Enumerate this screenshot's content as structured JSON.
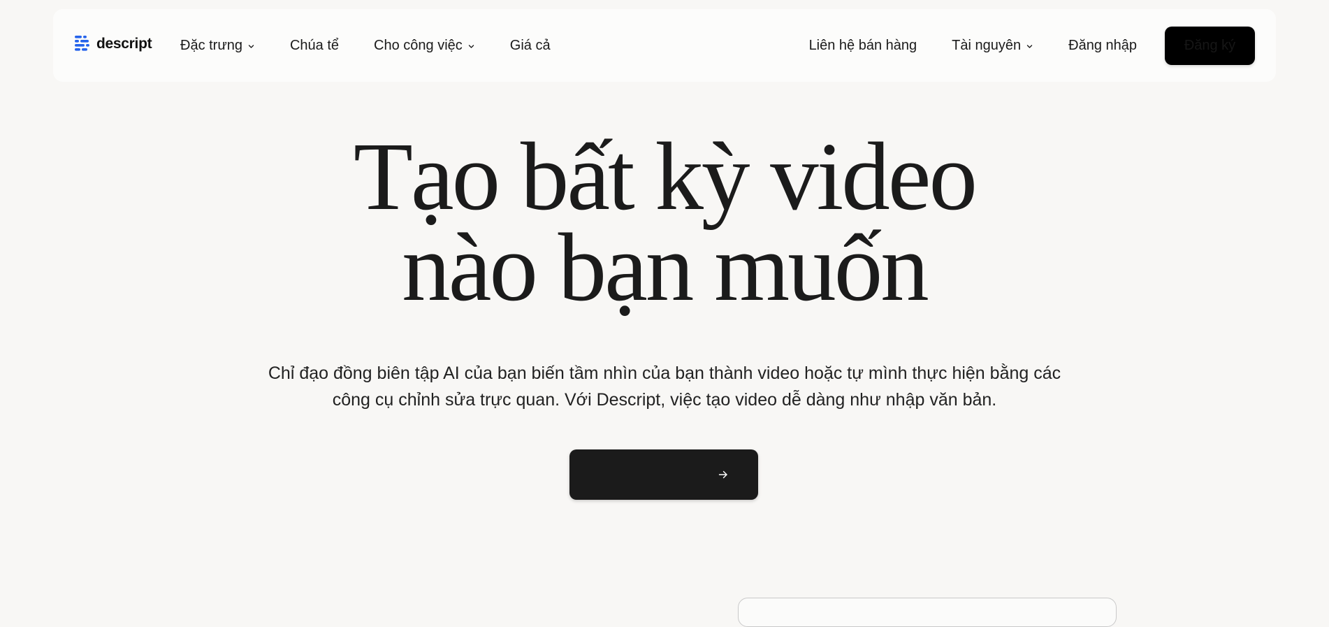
{
  "brand": {
    "name": "descript",
    "logo_icon": "descript-logo-icon",
    "accent_color": "#2563eb"
  },
  "nav": {
    "left": [
      {
        "label": "Đặc trưng",
        "has_dropdown": true
      },
      {
        "label": "Chúa tể",
        "has_dropdown": false
      },
      {
        "label": "Cho công việc",
        "has_dropdown": true
      },
      {
        "label": "Giá cả",
        "has_dropdown": false
      }
    ],
    "right": [
      {
        "label": "Liên hệ bán hàng",
        "has_dropdown": false
      },
      {
        "label": "Tài nguyên",
        "has_dropdown": true
      },
      {
        "label": "Đăng nhập",
        "has_dropdown": false
      }
    ],
    "signup_label": "Đăng ký"
  },
  "hero": {
    "title_line1": "Tạo bất kỳ video",
    "title_line2": "nào bạn muốn",
    "subtitle_line1": "Chỉ đạo đồng biên tập AI của bạn biến tầm nhìn của bạn thành video hoặc tự mình thực hiện bằng các",
    "subtitle_line2": "công cụ chỉnh sửa trực quan. Với Descript, việc tạo video dễ dàng như nhập văn bản.",
    "cta": {
      "label": "",
      "icon": "arrow-right-icon"
    }
  },
  "colors": {
    "page_background": "#f8f7f5",
    "header_background": "#fcfcfb",
    "text": "#1b1b1b",
    "signup_background": "#000000",
    "cta_background": "#1b1b1b"
  }
}
